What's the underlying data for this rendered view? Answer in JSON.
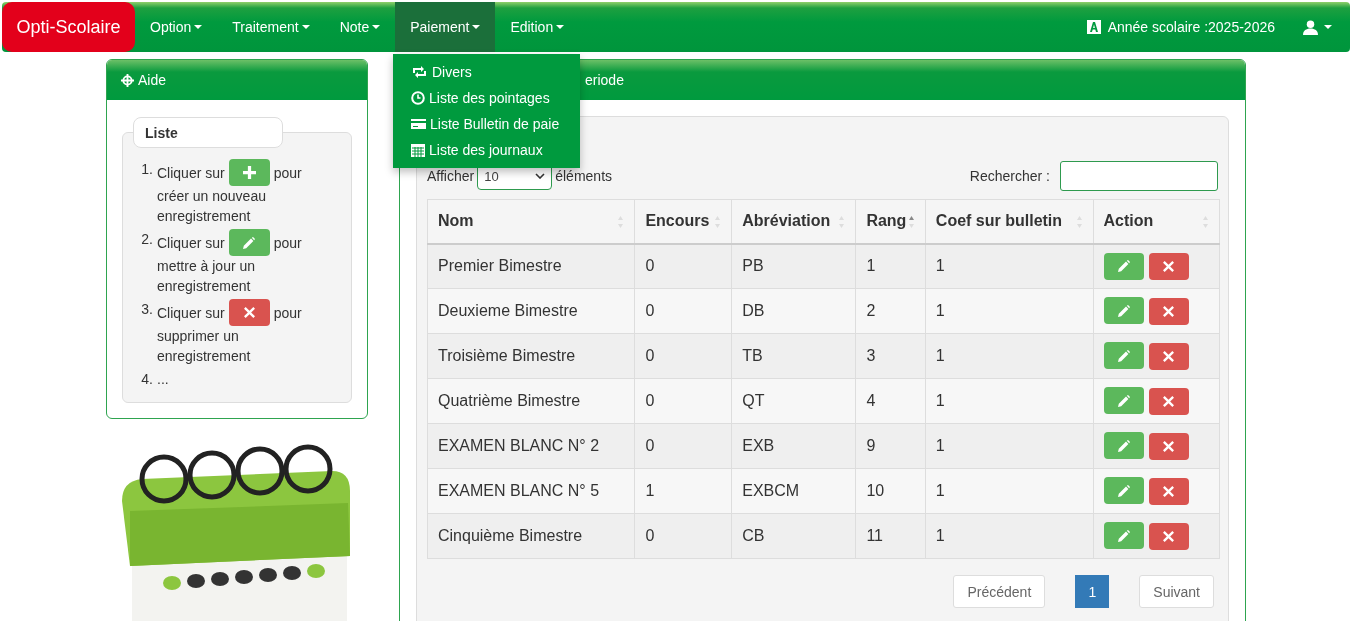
{
  "navbar": {
    "brand": "Opti-Scolaire",
    "menus": [
      {
        "label": "Option",
        "selected": false
      },
      {
        "label": "Traitement",
        "selected": false
      },
      {
        "label": "Note",
        "selected": false
      },
      {
        "label": "Paiement",
        "selected": true
      },
      {
        "label": "Edition",
        "selected": false
      }
    ],
    "year": "Année scolaire :2025-2026"
  },
  "dropdown": [
    {
      "kind": "repeat",
      "label": "Divers"
    },
    {
      "kind": "clock",
      "label": "Liste des pointages"
    },
    {
      "kind": "card",
      "label": "Liste Bulletin de paie"
    },
    {
      "kind": "calendar",
      "label": "Liste des journaux"
    }
  ],
  "help": {
    "title": "Aide",
    "list_title": "Liste",
    "steps": [
      {
        "number": "1.",
        "kind": "add",
        "before": "Cliquer sur",
        "after": "pour",
        "rest": "créer un nouveau enregistrement"
      },
      {
        "number": "2.",
        "kind": "edit",
        "before": "Cliquer sur",
        "after": "pour",
        "rest": "mettre à jour un enregistrement"
      },
      {
        "number": "3.",
        "kind": "delete",
        "before": "Cliquer sur",
        "after": "pour",
        "rest": "supprimer un enregistrement"
      },
      {
        "number": "4.",
        "kind": "more",
        "before": "..."
      }
    ]
  },
  "panel": {
    "title": "eriode",
    "show_label": "Afficher",
    "page_size": "10",
    "show_suffix": "éléments",
    "search_label": "Rechercher :",
    "table": {
      "columns": [
        {
          "label": "Nom",
          "sorted": false
        },
        {
          "label": "Encours",
          "sorted": false
        },
        {
          "label": "Abréviation",
          "sorted": false
        },
        {
          "label": "Rang",
          "sorted": true
        },
        {
          "label": "Coef sur bulletin",
          "sorted": false
        },
        {
          "label": "Action",
          "sorted": false
        }
      ],
      "rows": [
        [
          "Premier Bimestre",
          "0",
          "PB",
          "1",
          "1"
        ],
        [
          "Deuxieme Bimestre",
          "0",
          "DB",
          "2",
          "1"
        ],
        [
          "Troisième Bimestre",
          "0",
          "TB",
          "3",
          "1"
        ],
        [
          "Quatrième Bimestre",
          "0",
          "QT",
          "4",
          "1"
        ],
        [
          "EXAMEN BLANC N° 2",
          "0",
          "EXB",
          "9",
          "1"
        ],
        [
          "EXAMEN BLANC N° 5",
          "1",
          "EXBCM",
          "10",
          "1"
        ],
        [
          "Cinquième Bimestre",
          "0",
          "CB",
          "11",
          "1"
        ]
      ]
    },
    "pagination": {
      "previous": "Précédent",
      "pages": [
        {
          "label": "1",
          "selected": true
        }
      ],
      "next": "Suivant"
    }
  }
}
